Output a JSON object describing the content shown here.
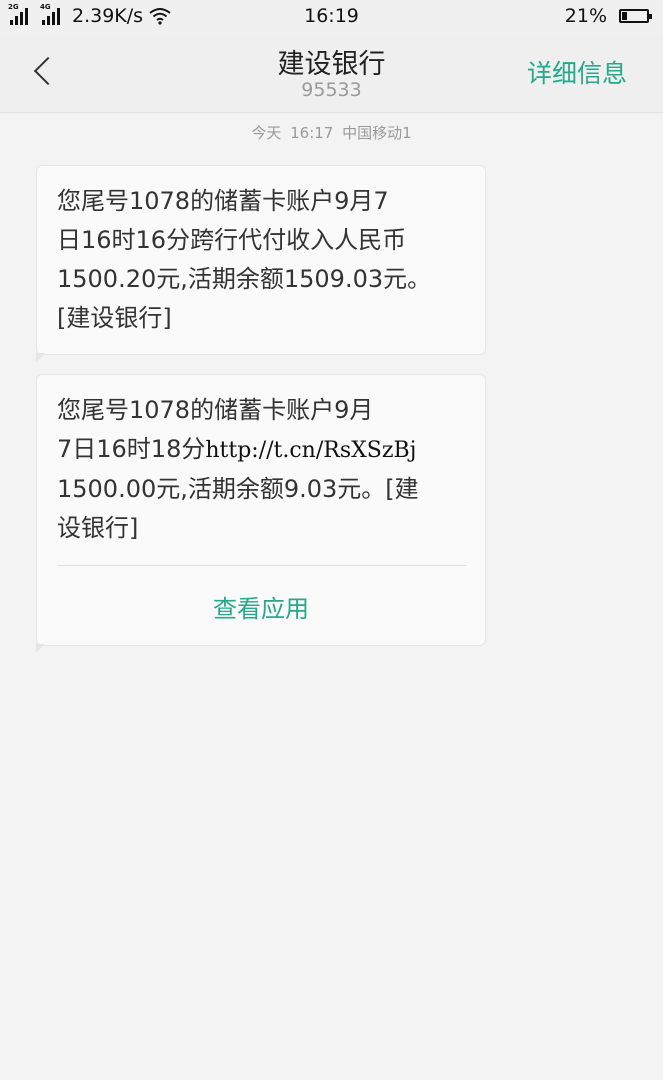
{
  "status_bar": {
    "network_speed": "2.39K/s",
    "time": "16:19",
    "battery": "21%",
    "battery_level": 0.21,
    "sim1_tag": "2G",
    "sim2_tag": "4G"
  },
  "header": {
    "title": "建设银行",
    "number": "95533",
    "detail_label": "详细信息"
  },
  "conversation": {
    "timestamp": "今天 16:17 中国移动1",
    "messages": [
      {
        "lines": [
          "您尾号1078的储蓄卡账户9月7",
          "日16时16分跨行代付收入人民币",
          "1500.20元,活期余额1509.03元。",
          "[建设银行]"
        ]
      },
      {
        "line1": "您尾号1078的储蓄卡账户9月",
        "line2_text": "7日16时18分",
        "line2_link": "http://t.cn/RsXSzBj",
        "line3": "1500.00元,活期余额9.03元。[建",
        "line4": "设银行]",
        "action_label": "查看应用"
      }
    ]
  },
  "colors": {
    "accent": "#25a88b",
    "background": "#f3f3f3",
    "bubble": "#fafafa"
  }
}
